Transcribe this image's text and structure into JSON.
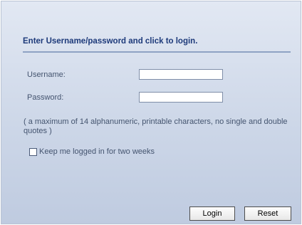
{
  "login": {
    "heading": "Enter Username/password and click to login.",
    "username_label": "Username:",
    "username_value": "",
    "password_label": "Password:",
    "password_value": "",
    "note": "( a maximum of 14 alphanumeric, printable characters, no single and double quotes )",
    "keep_logged_in_label": "Keep me logged in for two weeks",
    "keep_logged_in_checked": false,
    "login_button": "Login",
    "reset_button": "Reset"
  },
  "colors": {
    "heading": "#1d3a7a",
    "label": "#44546f",
    "panel_top": "#e2e8f3",
    "panel_bottom": "#bfcbe0"
  }
}
